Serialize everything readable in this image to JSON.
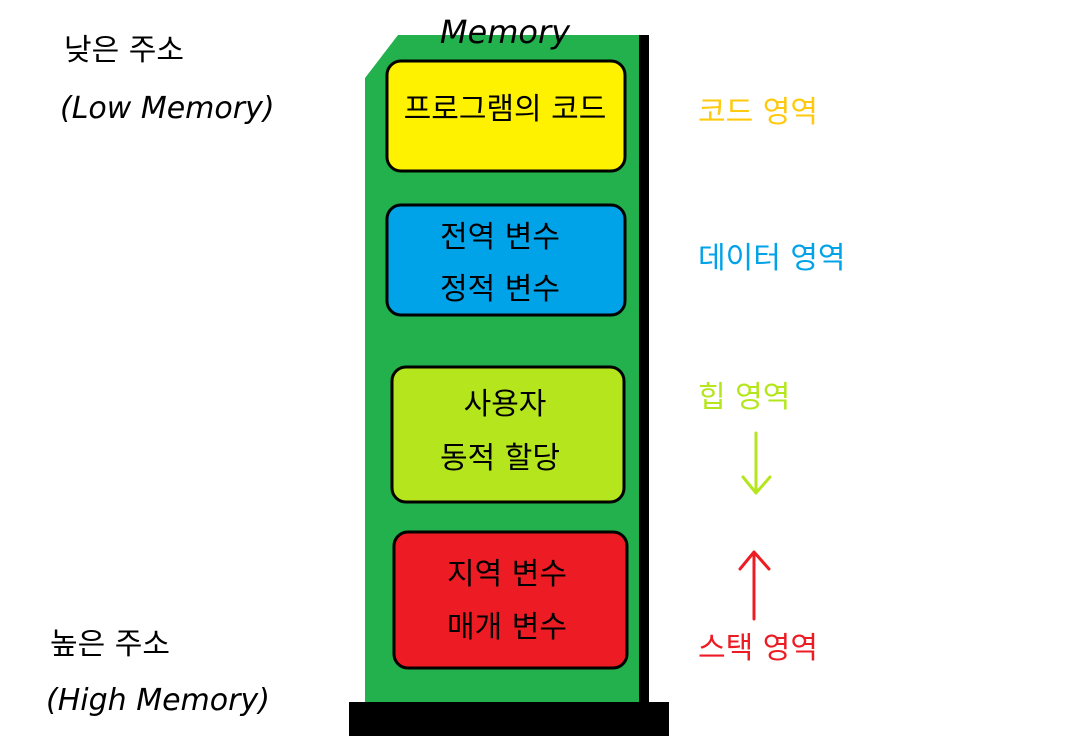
{
  "title": "Memory",
  "address_labels": {
    "low_korean": "낮은 주소",
    "low_english": "(Low Memory)",
    "high_korean": "높은 주소",
    "high_english": "(High Memory)"
  },
  "blocks": {
    "code": {
      "lines": [
        "프로그램의 코드"
      ],
      "color": "#fff200"
    },
    "data": {
      "lines": [
        "전역 변수",
        "정적 변수"
      ],
      "color": "#00a2e8"
    },
    "heap": {
      "lines": [
        "사용자",
        "동적 할당"
      ],
      "color": "#b5e61d"
    },
    "stack": {
      "lines": [
        "지역 변수",
        "매개 변수"
      ],
      "color": "#ed1c24"
    }
  },
  "region_labels": {
    "code": {
      "text": "코드 영역",
      "color": "#ffc90e"
    },
    "data": {
      "text": "데이터 영역",
      "color": "#00a2e8"
    },
    "heap": {
      "text": "힙 영역",
      "color": "#b5e61d"
    },
    "stack": {
      "text": "스택 영역",
      "color": "#ed1c24"
    }
  },
  "colors": {
    "board": "#22b14c",
    "outline": "#000000"
  }
}
